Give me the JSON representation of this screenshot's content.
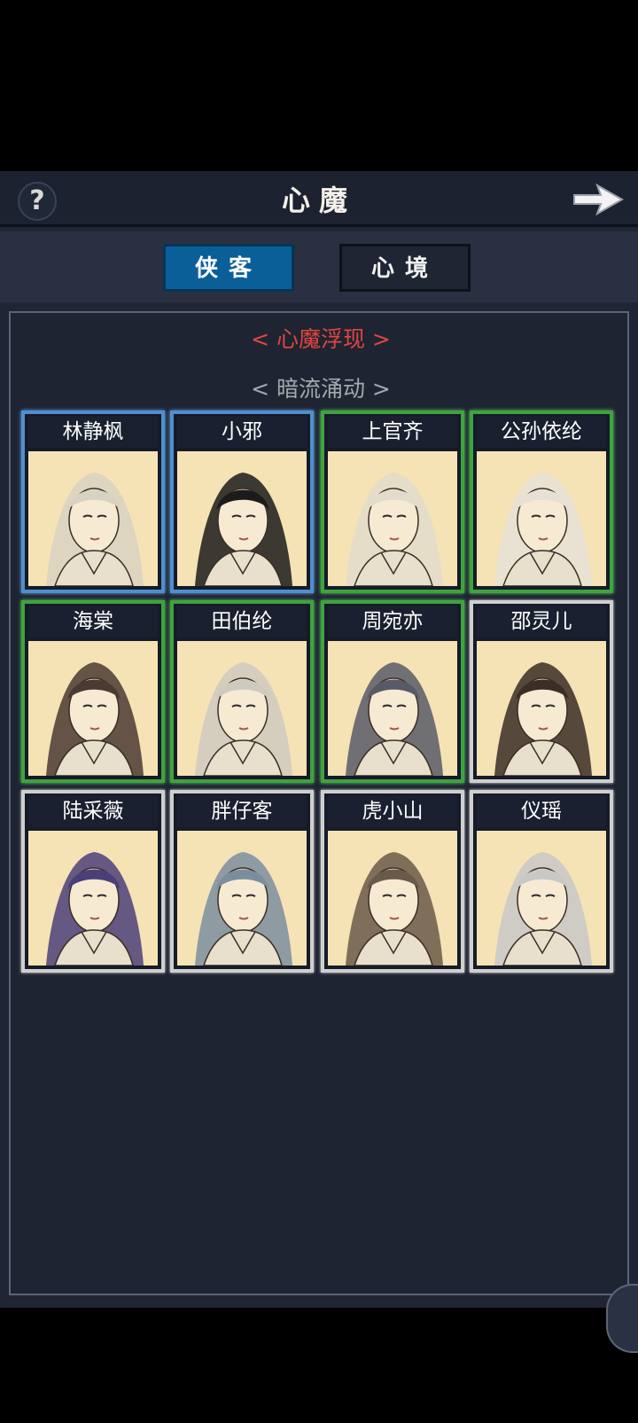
{
  "header": {
    "title": "心魔",
    "help_icon": "question-mark-icon",
    "next_icon": "arrow-right-icon"
  },
  "tabs": [
    {
      "label": "侠客",
      "active": true
    },
    {
      "label": "心境",
      "active": false
    }
  ],
  "sections": {
    "current": "< 心魔浮现 >",
    "other": "< 暗流涌动 >"
  },
  "colors": {
    "background": "#1f2533",
    "active_tab": "#0a5f99",
    "accent_red": "#e0463f",
    "frame_blue": "#4f8fcf",
    "frame_green": "#3fa33f",
    "frame_white": "#cfcfcf",
    "portrait_bg": "#f6e3b5"
  },
  "characters": [
    {
      "name": "林静枫",
      "frame": "blue",
      "hair": "#d8d2c2"
    },
    {
      "name": "小邪",
      "frame": "blue",
      "hair": "#1b1b1b"
    },
    {
      "name": "上官齐",
      "frame": "green",
      "hair": "#e3dccb"
    },
    {
      "name": "公孙依纶",
      "frame": "green",
      "hair": "#e6e1d6"
    },
    {
      "name": "海棠",
      "frame": "green",
      "hair": "#4a3a32"
    },
    {
      "name": "田伯纶",
      "frame": "green",
      "hair": "#cfcac0"
    },
    {
      "name": "周宛亦",
      "frame": "green",
      "hair": "#585a68"
    },
    {
      "name": "邵灵儿",
      "frame": "white",
      "hair": "#3a2e26"
    },
    {
      "name": "陆采薇",
      "frame": "white",
      "hair": "#4b3f7a"
    },
    {
      "name": "胖仔客",
      "frame": "white",
      "hair": "#7b8ea0"
    },
    {
      "name": "虎小山",
      "frame": "white",
      "hair": "#6a5a4a"
    },
    {
      "name": "仪瑶",
      "frame": "white",
      "hair": "#c8c8c8"
    }
  ]
}
